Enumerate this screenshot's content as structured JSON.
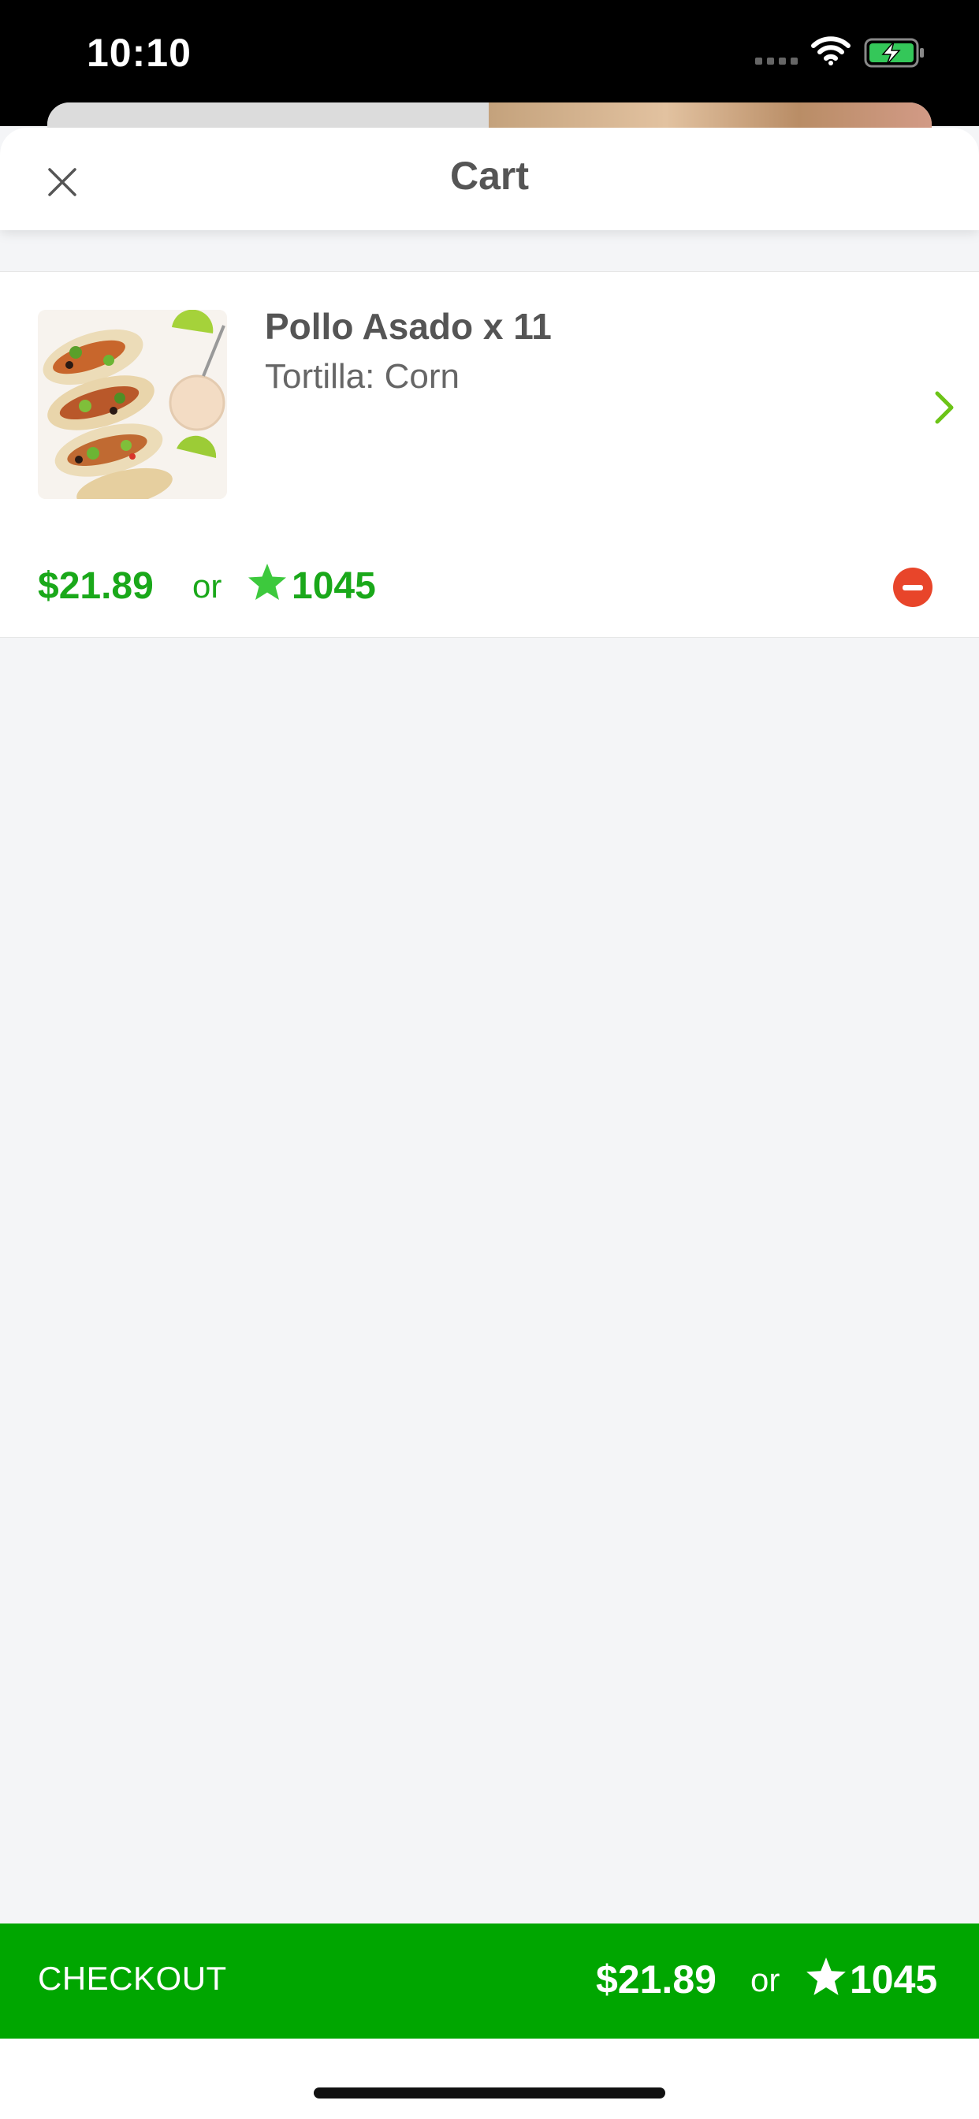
{
  "status_bar": {
    "time": "10:10"
  },
  "header": {
    "title": "Cart"
  },
  "cart_item": {
    "name": "Pollo Asado x 11",
    "option": "Tortilla: Corn",
    "price": "$21.89",
    "or_text": "or",
    "points": "1045"
  },
  "checkout": {
    "label": "CHECKOUT",
    "price": "$21.89",
    "or_text": "or",
    "points": "1045"
  },
  "colors": {
    "accent_green": "#1aa81a",
    "checkout_bg": "#00a600",
    "star_green": "#3dc93d",
    "remove_red": "#e8452a",
    "chevron_green": "#6cc417"
  },
  "icons": {
    "close": "close-icon",
    "chevron": "chevron-right-icon",
    "star": "star-icon",
    "remove": "remove-icon"
  }
}
